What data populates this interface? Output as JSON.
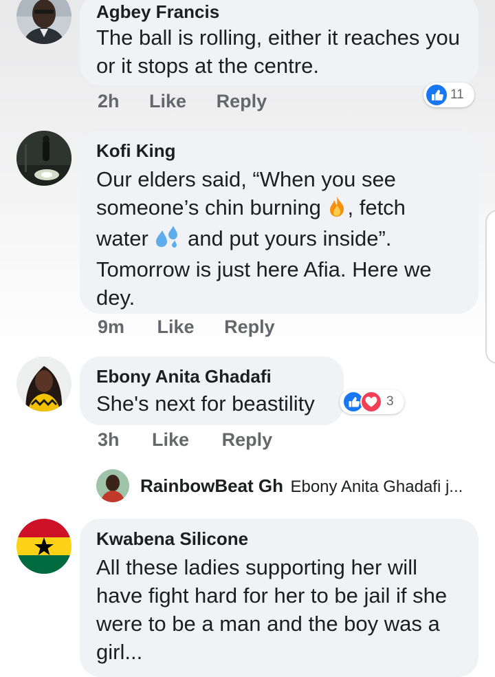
{
  "comments": [
    {
      "author": "Agbey Francis",
      "text": "The ball is rolling, either it reaches you or it stops at the centre.",
      "time": "2h",
      "like_label": "Like",
      "reply_label": "Reply",
      "reaction_count": "11",
      "avatar_icon": "profile-photo-man"
    },
    {
      "author": "Kofi King",
      "text_part1": "Our elders said, “When you see someone’s chin burning ",
      "text_part2": ", fetch water ",
      "text_part3": " and put yours inside”. Tomorrow is just here Afia. Here we dey.",
      "time": "9m",
      "like_label": "Like",
      "reply_label": "Reply",
      "avatar_icon": "profile-photo-dark-street"
    },
    {
      "author": "Ebony Anita Ghadafi",
      "text": "She's next for beastility",
      "time": "3h",
      "like_label": "Like",
      "reply_label": "Reply",
      "reaction_count": "3",
      "avatar_icon": "profile-photo-woman"
    },
    {
      "author": "Kwabena Silicone",
      "text": "All these ladies supporting her will have fight hard for her to be jail if she were to be a man and the boy was a girl...",
      "avatar_icon": "ghana-flag"
    }
  ],
  "reply_preview": {
    "author": "RainbowBeat Gh",
    "snippet": "Ebony Anita Ghadafi j..."
  },
  "colors": {
    "bubble": "#f0f2f5",
    "meta_text": "#65676b",
    "like_blue": "#1877f2",
    "love_red": "#f33e58"
  }
}
